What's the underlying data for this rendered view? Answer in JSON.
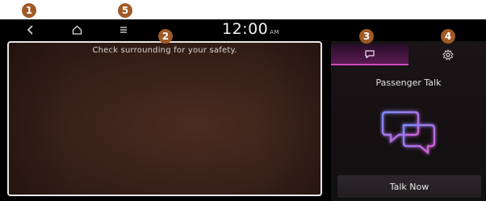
{
  "callouts": {
    "one": "1",
    "two": "2",
    "three": "3",
    "four": "4",
    "five": "5"
  },
  "topbar": {
    "back_icon": "back-icon",
    "home_icon": "home-icon",
    "menu_icon": "menu-icon",
    "time": "12:00",
    "meridiem": "AM"
  },
  "camera": {
    "safety_message": "Check surrounding for your safety."
  },
  "panel": {
    "tabs": [
      {
        "icon": "chat-icon",
        "active": true
      },
      {
        "icon": "gear-icon",
        "active": false
      }
    ],
    "title": "Passenger Talk",
    "talk_button_label": "Talk Now",
    "accent_color": "#d14bc2"
  }
}
